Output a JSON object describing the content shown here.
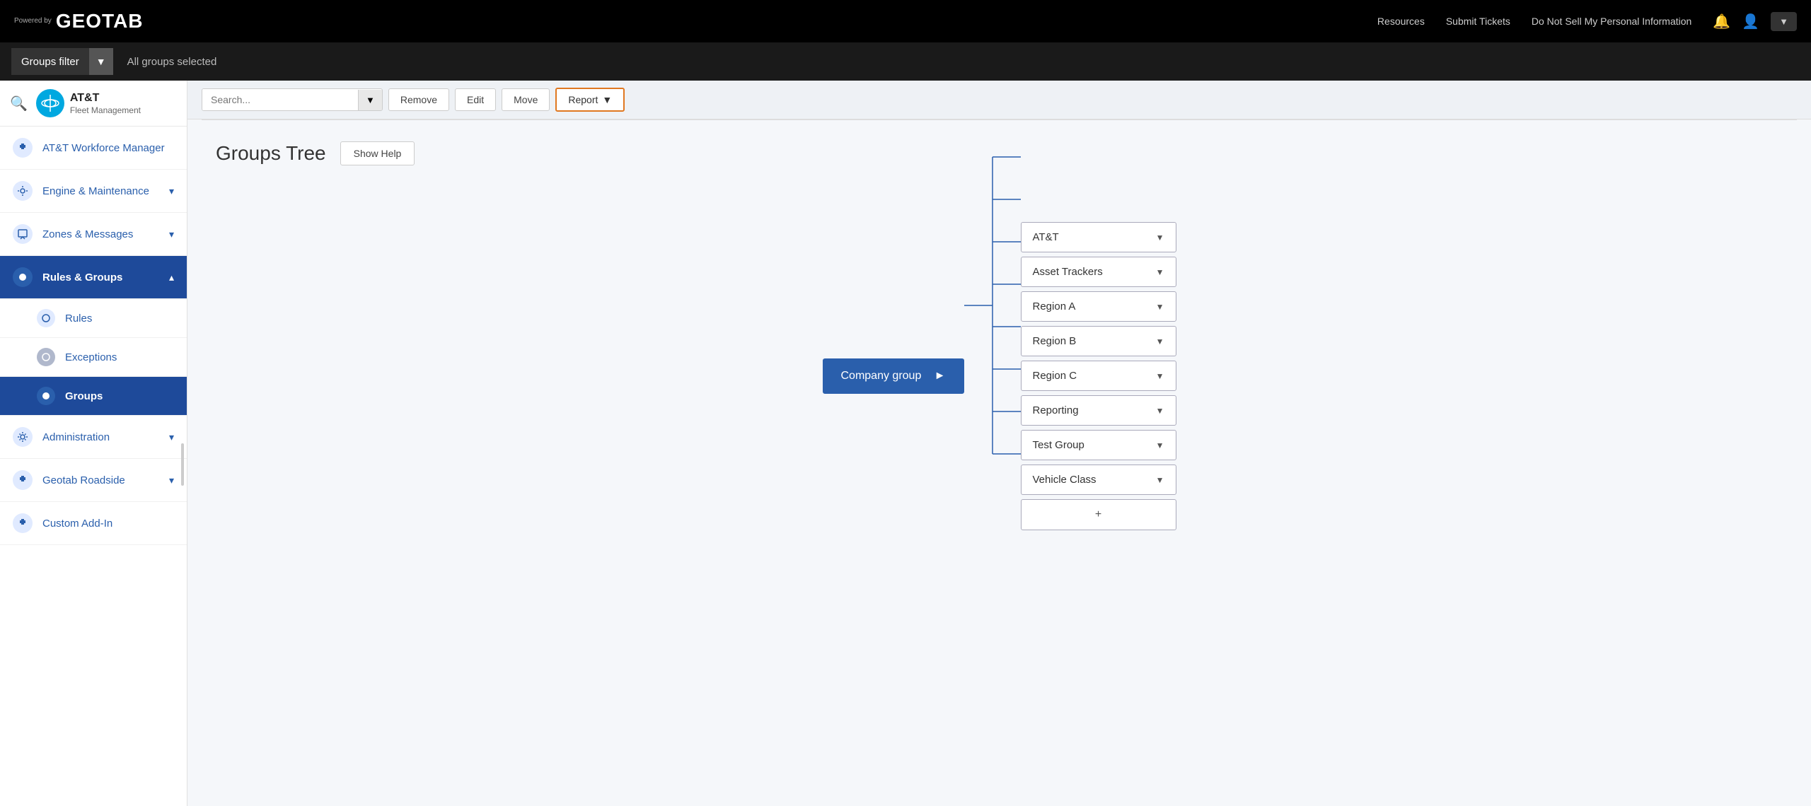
{
  "topNav": {
    "poweredBy": "Powered by",
    "logoText": "GEOTAB",
    "links": [
      {
        "label": "Resources",
        "name": "resources-link"
      },
      {
        "label": "Submit Tickets",
        "name": "submit-tickets-link"
      },
      {
        "label": "Do Not Sell My Personal Information",
        "name": "do-not-sell-link"
      }
    ],
    "bellIcon": "🔔",
    "userIcon": "👤",
    "userDropdownArrow": "▼"
  },
  "groupsFilterBar": {
    "filterLabel": "Groups filter",
    "dropdownArrow": "▼",
    "allGroupsText": "All groups selected"
  },
  "sidebar": {
    "searchPlaceholder": "Search...",
    "logoAlt": "AT&T",
    "logoSub": "Fleet Management",
    "items": [
      {
        "label": "AT&T Workforce Manager",
        "name": "att-workforce-manager",
        "icon": "🔷",
        "hasChevron": false
      },
      {
        "label": "Engine & Maintenance",
        "name": "engine-maintenance",
        "icon": "⚙",
        "hasChevron": true
      },
      {
        "label": "Zones & Messages",
        "name": "zones-messages",
        "icon": "✉",
        "hasChevron": true
      },
      {
        "label": "Rules & Groups",
        "name": "rules-groups",
        "icon": "●",
        "hasChevron": true,
        "active": true,
        "subItems": [
          {
            "label": "Rules",
            "name": "rules-sub",
            "icon": "○"
          },
          {
            "label": "Exceptions",
            "name": "exceptions-sub",
            "icon": "○"
          },
          {
            "label": "Groups",
            "name": "groups-sub",
            "icon": "●",
            "active": true
          }
        ]
      },
      {
        "label": "Administration",
        "name": "administration",
        "icon": "⚙",
        "hasChevron": true
      },
      {
        "label": "Geotab Roadside",
        "name": "geotab-roadside",
        "icon": "🔷",
        "hasChevron": true
      },
      {
        "label": "Custom Add-In",
        "name": "custom-add-in",
        "icon": "🔷",
        "hasChevron": false
      }
    ]
  },
  "toolbar": {
    "searchPlaceholder": "Search...",
    "searchDropdownArrow": "▼",
    "removeLabel": "Remove",
    "editLabel": "Edit",
    "moveLabel": "Move",
    "reportLabel": "Report",
    "reportDropdownArrow": "▼"
  },
  "page": {
    "title": "Groups Tree",
    "showHelpLabel": "Show Help"
  },
  "tree": {
    "companyGroupLabel": "Company group",
    "companyGroupArrow": "►",
    "children": [
      {
        "label": "AT&T",
        "name": "att-node"
      },
      {
        "label": "Asset Trackers",
        "name": "asset-trackers-node"
      },
      {
        "label": "Region A",
        "name": "region-a-node"
      },
      {
        "label": "Region B",
        "name": "region-b-node"
      },
      {
        "label": "Region C",
        "name": "region-c-node"
      },
      {
        "label": "Reporting",
        "name": "reporting-node"
      },
      {
        "label": "Test Group",
        "name": "test-group-node"
      },
      {
        "label": "Vehicle Class",
        "name": "vehicle-class-node"
      }
    ],
    "addButtonLabel": "+"
  }
}
